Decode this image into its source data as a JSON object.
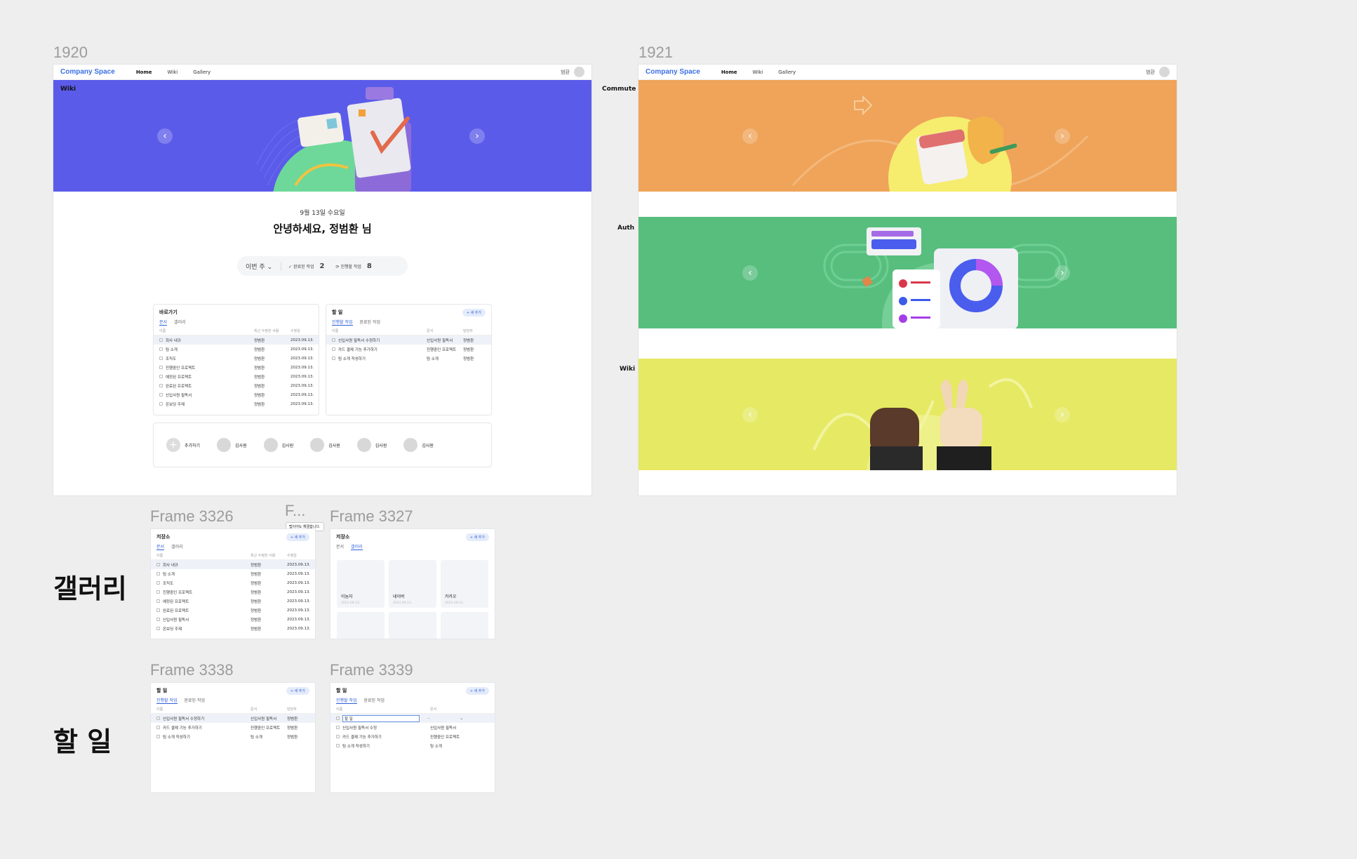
{
  "frames": {
    "f1920_label": "1920",
    "f1921_label": "1921",
    "frame3326_label": "Frame 3326",
    "frame3327_label": "Frame 3327",
    "frame3338_label": "Frame 3338",
    "frame3339_label": "Frame 3339",
    "frame_small_label": "F..."
  },
  "nav": {
    "brand": "Company Space",
    "items": [
      "Home",
      "Wiki",
      "Gallery"
    ],
    "user": "범환"
  },
  "banners": {
    "wiki_tag": "Wiki",
    "commute_tag": "Commute",
    "auth_tag": "Auth",
    "wiki2_tag": "Wiki",
    "colors": {
      "wiki": "#5b5bea",
      "commute": "#efa45a",
      "auth": "#57be7e",
      "wiki2": "#e6e963"
    }
  },
  "greeting": {
    "date": "9월 13일 수요일",
    "hello": "안녕하세요, 정범환 님",
    "period": "이번 주",
    "done_label": "완료된 작업",
    "done_count": "2",
    "progress_label": "진행할 작업",
    "progress_count": "8"
  },
  "shortcuts": {
    "title": "바로가기",
    "tabs": [
      "문서",
      "갤러리"
    ],
    "headers": [
      "이름",
      "최근 수정한 사람",
      "수정일"
    ],
    "rows": [
      {
        "name": "회사 내규",
        "editor": "정범환",
        "date": "2023.09.13."
      },
      {
        "name": "팀 소개",
        "editor": "정범환",
        "date": "2023.09.13."
      },
      {
        "name": "조직도",
        "editor": "정범환",
        "date": "2023.09.13."
      },
      {
        "name": "진행중인 프로젝트",
        "editor": "정범환",
        "date": "2023.09.13."
      },
      {
        "name": "예정된 프로젝트",
        "editor": "정범환",
        "date": "2023.09.13."
      },
      {
        "name": "완료된 프로젝트",
        "editor": "정범환",
        "date": "2023.09.13."
      },
      {
        "name": "신입사원 필독서",
        "editor": "정범환",
        "date": "2023.09.13."
      },
      {
        "name": "온보딩 주제",
        "editor": "정범환",
        "date": "2023.09.13."
      }
    ]
  },
  "todo": {
    "title": "할 일",
    "add": "+ 새 추가",
    "tabs": [
      "진행할 작업",
      "완료된 작업"
    ],
    "headers": [
      "이름",
      "문서",
      "담당자"
    ],
    "rows": [
      {
        "name": "신입사원 필독서 수정하기",
        "doc": "신입사원 필독서",
        "owner": "정범환"
      },
      {
        "name": "카드 결제 기능 추가하기",
        "doc": "진행중인 프로젝트",
        "owner": "정범환"
      },
      {
        "name": "팀 소개 작성하기",
        "doc": "팀 소개",
        "owner": "정범환"
      }
    ]
  },
  "members": {
    "add": "추가하기",
    "names": [
      "김사원",
      "김사원",
      "김사원",
      "김사원",
      "김사원"
    ]
  },
  "storage": {
    "title": "저장소",
    "add": "+ 새 추가",
    "tabs": [
      "문서",
      "갤러리"
    ],
    "headers": [
      "이름",
      "최근 수정한 사람",
      "수정일"
    ],
    "rows": [
      {
        "name": "회사 내규",
        "editor": "정범환",
        "date": "2023.09.13."
      },
      {
        "name": "팀 소개",
        "editor": "정범환",
        "date": "2023.09.13."
      },
      {
        "name": "조직도",
        "editor": "정범환",
        "date": "2023.09.13."
      },
      {
        "name": "진행중인 프로젝트",
        "editor": "정범환",
        "date": "2023.09.13."
      },
      {
        "name": "예정된 프로젝트",
        "editor": "정범환",
        "date": "2023.09.13."
      },
      {
        "name": "완료된 프로젝트",
        "editor": "정범환",
        "date": "2023.09.13."
      },
      {
        "name": "신입사원 필독서",
        "editor": "정범환",
        "date": "2023.09.13."
      },
      {
        "name": "온보딩 주제",
        "editor": "정범환",
        "date": "2023.09.13."
      }
    ],
    "tooltip": "탭이어도 해결합니다.",
    "gallery": [
      {
        "name": "이놈자",
        "date": "2023.09.13."
      },
      {
        "name": "네이버",
        "date": "2023.09.13."
      },
      {
        "name": "카카오",
        "date": "2023.09.13."
      }
    ]
  },
  "todo3339": {
    "edit_value": "할 일",
    "select_value": "-",
    "rows": [
      {
        "name": "신입사원 필독서 수정",
        "doc": "신입사원 필독서"
      },
      {
        "name": "카드 결제 기능 추가하기",
        "doc": "진행중인 프로젝트"
      },
      {
        "name": "팀 소개 작성하기",
        "doc": "팀 소개"
      }
    ]
  },
  "sections": {
    "gallery": "갤러리",
    "todo": "할 일"
  }
}
